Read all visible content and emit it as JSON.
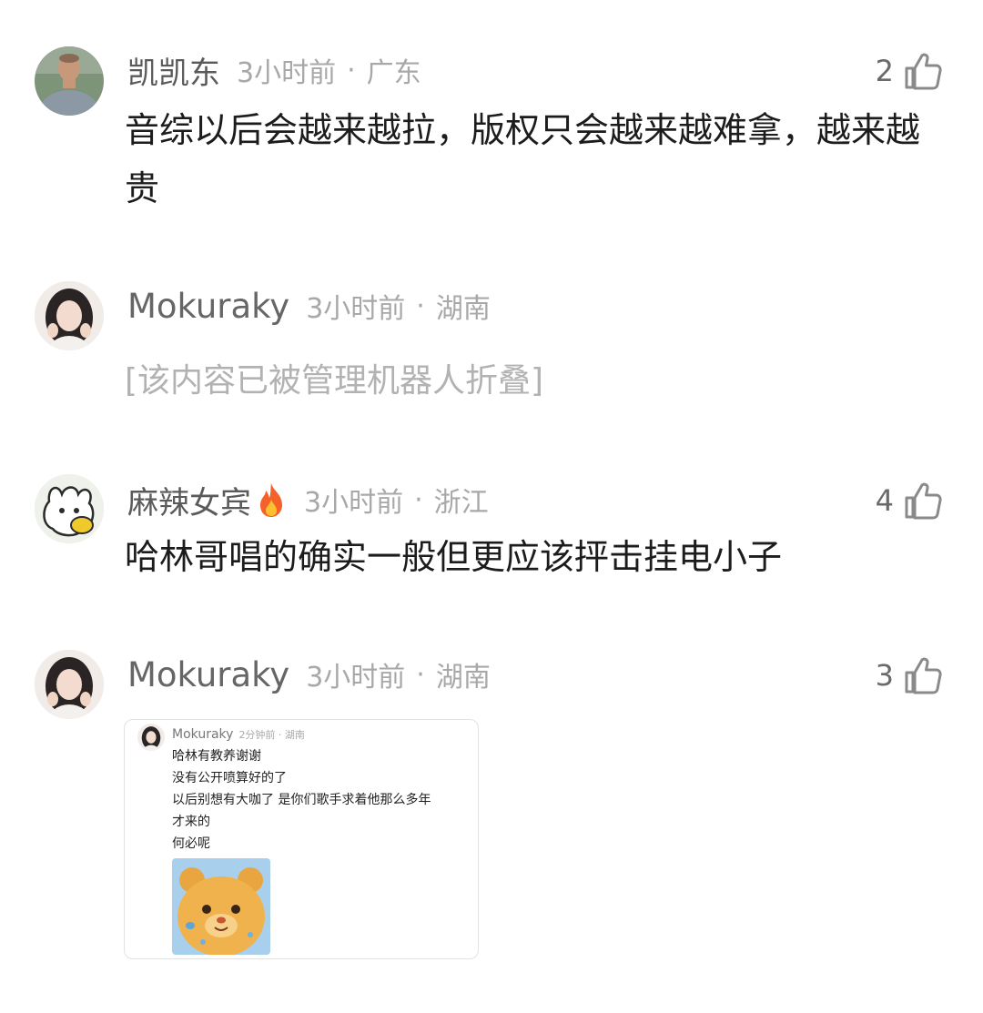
{
  "comments": [
    {
      "username": "凯凯东",
      "time": "3小时前",
      "separator": "·",
      "location": "广东",
      "likes": "2",
      "text": "音综以后会越来越拉，版权只会越来越难拿，越来越贵"
    },
    {
      "username": "Mokuraky",
      "time": "3小时前",
      "separator": "·",
      "location": "湖南",
      "folded_text": "[该内容已被管理机器人折叠]"
    },
    {
      "username": "麻辣女宾",
      "time": "3小时前",
      "separator": "·",
      "location": "浙江",
      "likes": "4",
      "text": "哈林哥唱的确实一般但更应该抨击挂电小子"
    },
    {
      "username": "Mokuraky",
      "time": "3小时前",
      "separator": "·",
      "location": "湖南",
      "likes": "3",
      "attachment": {
        "username": "Mokuraky",
        "meta": "2分钟前 · 湖南",
        "lines": [
          "哈林有教养谢谢",
          "没有公开喷算好的了",
          "以后别想有大咖了 是你们歌手求着他那么多年",
          "才来的",
          "何必呢"
        ]
      }
    }
  ],
  "icons": {
    "like": "thumbs-up-icon",
    "fire": "fire-icon"
  },
  "colors": {
    "text_primary": "#1c1c1c",
    "text_secondary": "#a8a8a8",
    "username": "#5a5a5a"
  }
}
